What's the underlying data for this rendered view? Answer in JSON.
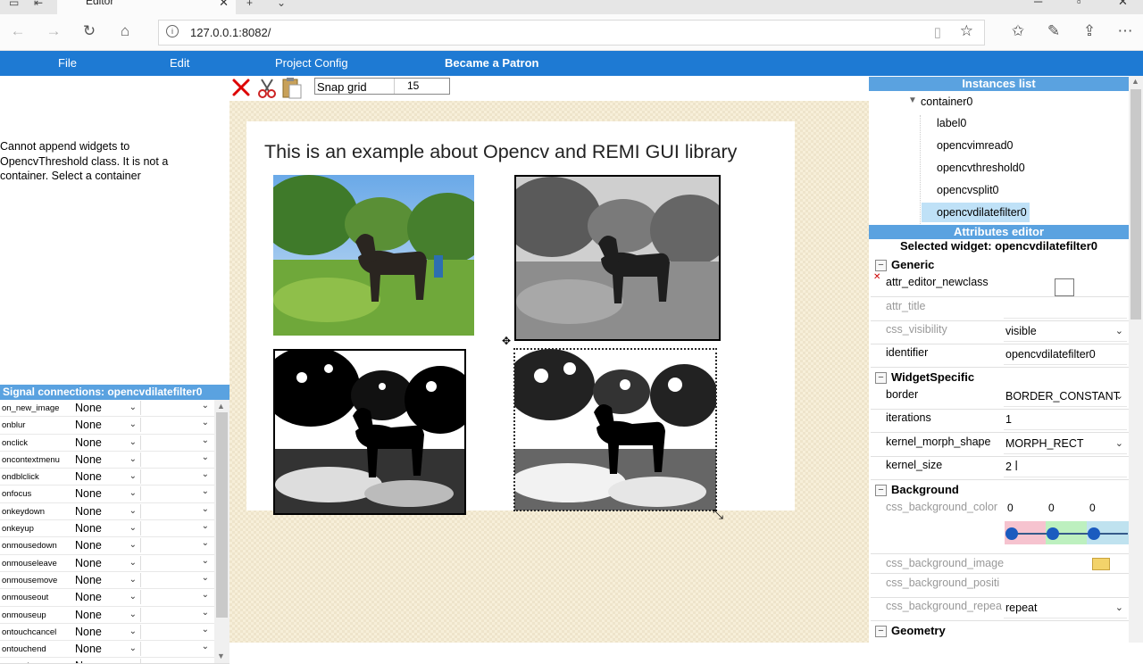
{
  "browser": {
    "tab_title": "Editor",
    "url": "127.0.0.1:8082/"
  },
  "menu": {
    "file": "File",
    "edit": "Edit",
    "project_config": "Project Config",
    "patron": "Became a Patron"
  },
  "left": {
    "status_message": "Cannot append widgets to OpencvThreshold class. It is not a container. Select a container",
    "signals_title": "Signal connections: opencvdilatefilter0",
    "signals": [
      {
        "name": "on_new_image",
        "value": "None"
      },
      {
        "name": "onblur",
        "value": "None"
      },
      {
        "name": "onclick",
        "value": "None"
      },
      {
        "name": "oncontextmenu",
        "value": "None"
      },
      {
        "name": "ondblclick",
        "value": "None"
      },
      {
        "name": "onfocus",
        "value": "None"
      },
      {
        "name": "onkeydown",
        "value": "None"
      },
      {
        "name": "onkeyup",
        "value": "None"
      },
      {
        "name": "onmousedown",
        "value": "None"
      },
      {
        "name": "onmouseleave",
        "value": "None"
      },
      {
        "name": "onmousemove",
        "value": "None"
      },
      {
        "name": "onmouseout",
        "value": "None"
      },
      {
        "name": "onmouseup",
        "value": "None"
      },
      {
        "name": "ontouchcancel",
        "value": "None"
      },
      {
        "name": "ontouchend",
        "value": "None"
      },
      {
        "name": "ontouchenter",
        "value": "None"
      }
    ]
  },
  "canvas": {
    "snap_label": "Snap grid",
    "snap_value": "15",
    "label_text": "This is an example about Opencv and REMI GUI library"
  },
  "right": {
    "instances_title": "Instances list",
    "tree": [
      "container0",
      "label0",
      "opencvimread0",
      "opencvthreshold0",
      "opencvsplit0",
      "opencvdilatefilter0"
    ],
    "attributes_title": "Attributes editor",
    "selected_widget": "Selected widget: opencvdilatefilter0",
    "groups": {
      "generic": "Generic",
      "widget_specific": "WidgetSpecific",
      "background": "Background",
      "geometry": "Geometry"
    },
    "generic_attrs": {
      "attr_editor_newclass": "attr_editor_newclass",
      "attr_title": "attr_title",
      "css_visibility": "css_visibility",
      "css_visibility_value": "visible",
      "identifier": "identifier",
      "identifier_value": "opencvdilatefilter0"
    },
    "specific_attrs": {
      "border": "border",
      "border_value": "BORDER_CONSTANT",
      "iterations": "iterations",
      "iterations_value": "1",
      "kernel_morph_shape": "kernel_morph_shape",
      "kernel_morph_shape_value": "MORPH_RECT",
      "kernel_size": "kernel_size",
      "kernel_size_value": "2"
    },
    "background_attrs": {
      "css_background_color": "css_background_color",
      "color_r": "0",
      "color_g": "0",
      "color_b": "0",
      "css_background_image": "css_background_image",
      "css_background_position": "css_background_positi",
      "css_background_repeat": "css_background_repea",
      "css_background_repeat_value": "repeat"
    },
    "colors": {
      "accent": "#1e7ad3",
      "panel_head": "#5aa2e0",
      "selected": "#bfe1f7"
    }
  }
}
